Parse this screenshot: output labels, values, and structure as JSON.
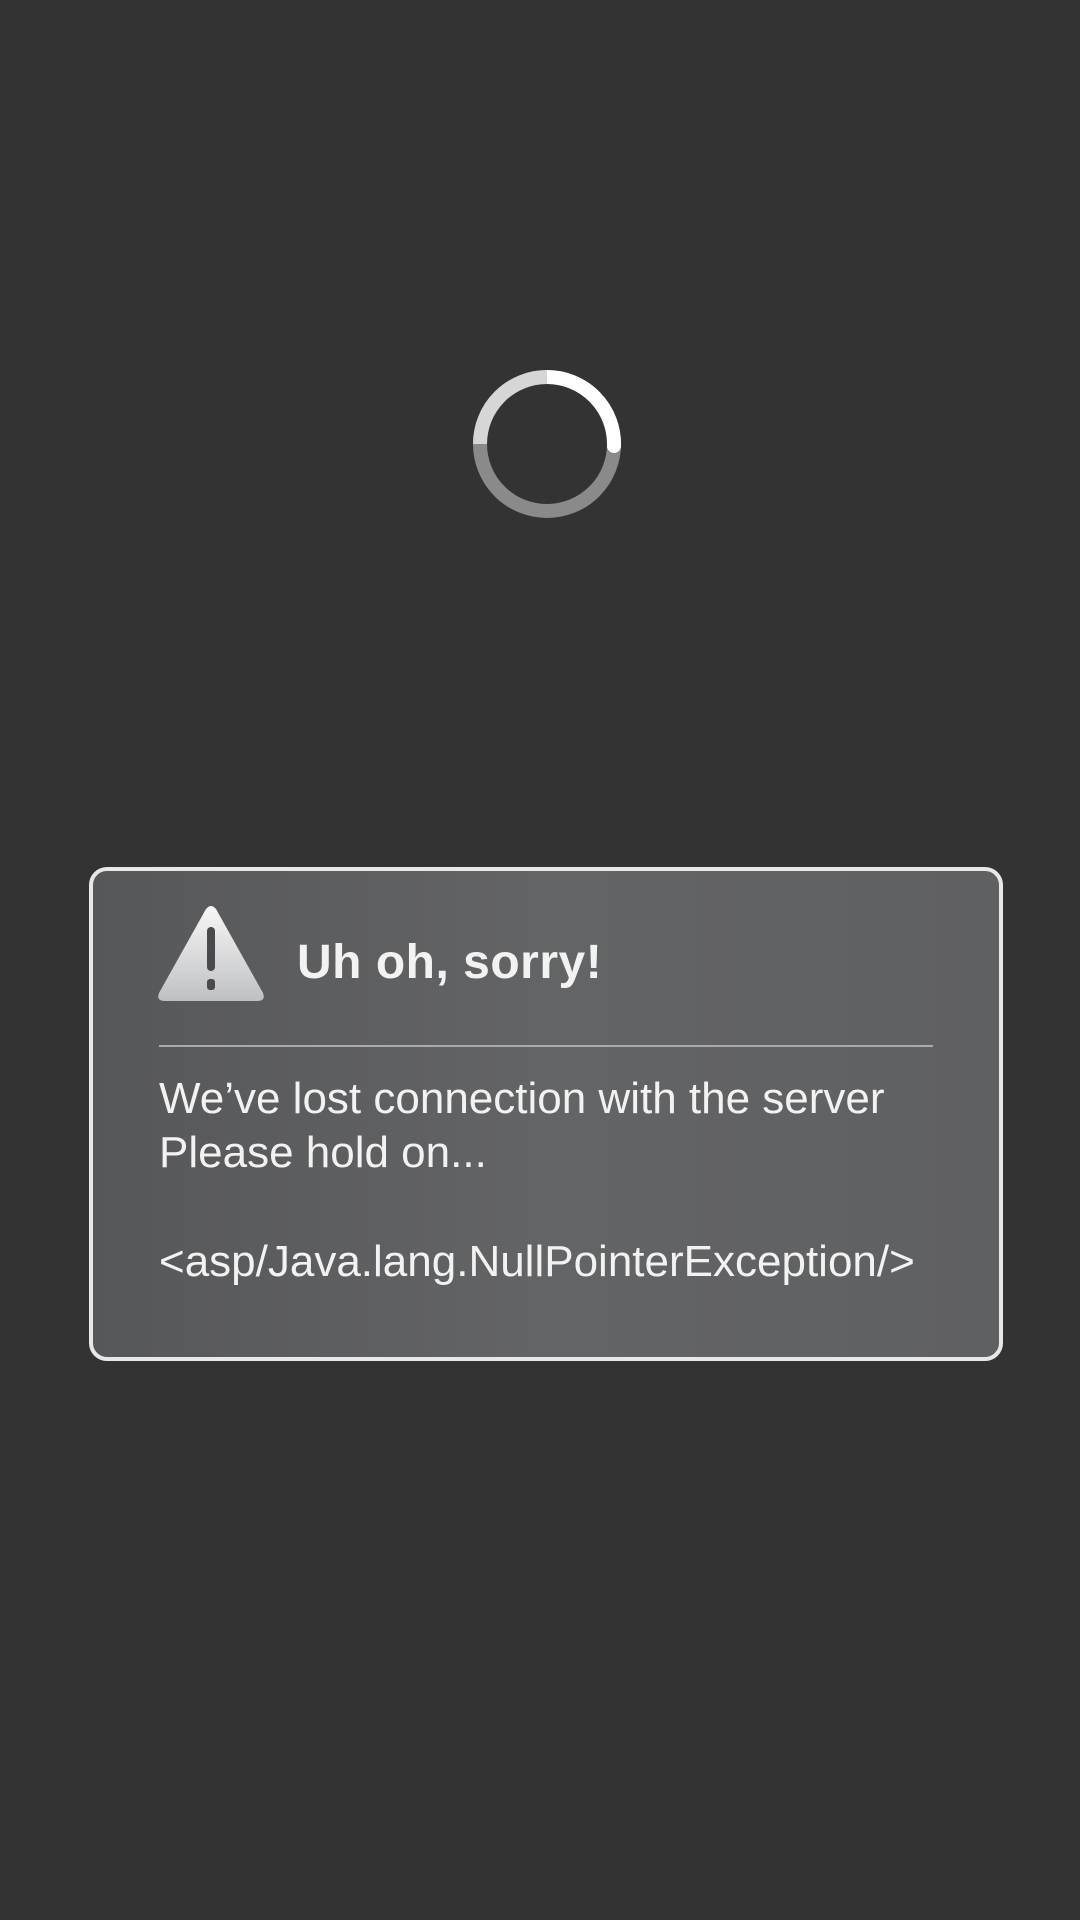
{
  "loading": {
    "icon": "loading-spinner"
  },
  "dialog": {
    "icon": "warning-icon",
    "title": "Uh oh,  sorry!",
    "message_line1": "We’ve lost connection with the server",
    "message_line2": "Please hold on...",
    "error_text": "<asp/Java.lang.NullPointerException/>"
  },
  "colors": {
    "background": "#333333",
    "dialog_border": "#e8e8e8",
    "dialog_fill": "#5f6062",
    "text": "#f2f2f2"
  }
}
